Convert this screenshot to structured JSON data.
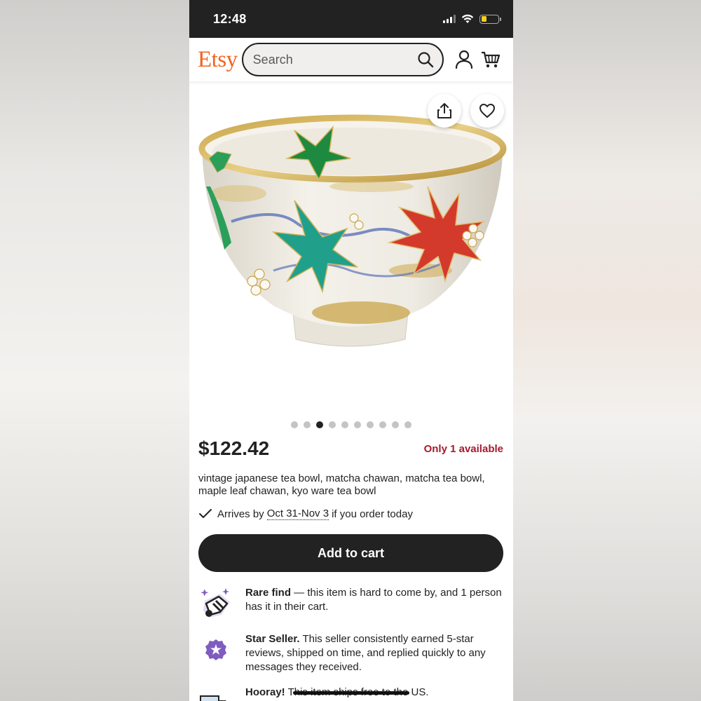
{
  "status_bar": {
    "time": "12:48"
  },
  "header": {
    "logo": "Etsy",
    "search_placeholder": "Search",
    "icons": [
      "search-icon",
      "account-icon",
      "cart-icon"
    ]
  },
  "gallery": {
    "actions": [
      "share-icon",
      "favorite-heart-icon"
    ],
    "image_count": 10,
    "active_index": 2
  },
  "listing": {
    "price": "$122.42",
    "availability": "Only 1 available",
    "title": "vintage japanese tea bowl, matcha chawan, matcha tea bowl, maple leaf chawan, kyo ware tea bowl",
    "arrives_prefix": "Arrives by",
    "arrives_date": "Oct 31-Nov 3",
    "arrives_suffix": "if you order today",
    "add_to_cart": "Add to cart"
  },
  "highlights": [
    {
      "icon": "rare-find-icon",
      "bold": "Rare find",
      "text": " — this item is hard to come by, and 1 person has it in their cart."
    },
    {
      "icon": "star-seller-badge-icon",
      "bold": "Star Seller.",
      "text": " This seller consistently earned 5-star reviews, shipped on time, and replied quickly to any messages they received."
    },
    {
      "icon": "shipping-truck-icon",
      "bold": "Hooray!",
      "text": " This item ships free to the US."
    }
  ],
  "colors": {
    "brand": "#F1641E",
    "availability": "#A61A2E",
    "button": "#222222",
    "star_seller": "#7F5CC0"
  }
}
